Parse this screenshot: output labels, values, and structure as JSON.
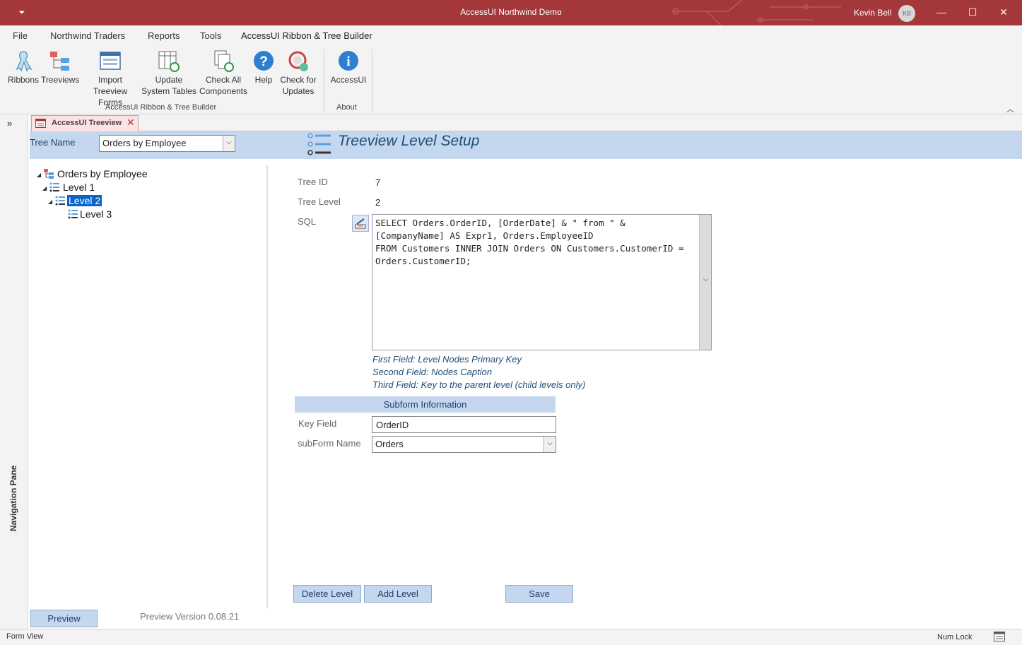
{
  "window": {
    "title": "AccessUI Northwind Demo",
    "user_name": "Kevin Bell",
    "user_initials": "KB",
    "qat_icon": "customize-quick-access-icon",
    "accent_color": "#a4373a"
  },
  "ribbon_tabs": [
    "File",
    "Northwind Traders",
    "Reports",
    "Tools",
    "AccessUI Ribbon & Tree Builder"
  ],
  "ribbon": {
    "buttons": [
      {
        "line1": "Ribbons",
        "line2": "",
        "icon": "ribbon-icon"
      },
      {
        "line1": "Treeviews",
        "line2": "",
        "icon": "treeview-icon"
      },
      {
        "line1": "Import",
        "line2": "Treeview Forms",
        "icon": "form-icon"
      },
      {
        "line1": "Update",
        "line2": "System Tables",
        "icon": "table-refresh-icon"
      },
      {
        "line1": "Check All",
        "line2": "Components",
        "icon": "check-components-icon"
      },
      {
        "line1": "Help",
        "line2": "",
        "icon": "help-icon"
      },
      {
        "line1": "Check for",
        "line2": "Updates",
        "icon": "update-icon"
      },
      {
        "line1": "AccessUI",
        "line2": "",
        "icon": "info-icon"
      }
    ],
    "group1_label": "AccessUI Ribbon & Tree Builder",
    "group2_label": "About"
  },
  "nav_pane": {
    "label": "Navigation Pane",
    "toggle": "»"
  },
  "doc_tab": {
    "label": "AccessUI Treeview",
    "close": "✕"
  },
  "form": {
    "tree_name_label": "Tree Name",
    "tree_name_value": "Orders by Employee",
    "title": "Treeview Level Setup",
    "tree": [
      {
        "label": "Orders by Employee",
        "level": 0,
        "expanded": true,
        "selected": false
      },
      {
        "label": "Level 1",
        "level": 1,
        "expanded": true,
        "selected": false
      },
      {
        "label": "Level 2",
        "level": 2,
        "expanded": true,
        "selected": true
      },
      {
        "label": "Level 3",
        "level": 3,
        "expanded": false,
        "selected": false
      }
    ],
    "tree_id_label": "Tree ID",
    "tree_id_value": "7",
    "tree_level_label": "Tree Level",
    "tree_level_value": "2",
    "sql_label": "SQL",
    "sql_value": "SELECT Orders.OrderID, [OrderDate] & \" from \" & [CompanyName] AS Expr1, Orders.EmployeeID\nFROM Customers INNER JOIN Orders ON Customers.CustomerID = Orders.CustomerID;",
    "notes": [
      "First Field: Level Nodes Primary Key",
      "Second Field: Nodes Caption",
      "Third Field:  Key to the parent level (child levels only)"
    ],
    "subform_header": "Subform Information",
    "key_field_label": "Key Field",
    "key_field_value": "OrderID",
    "subform_name_label": "subForm Name",
    "subform_name_value": "Orders",
    "buttons": {
      "delete": "Delete Level",
      "add": "Add Level",
      "save": "Save",
      "preview": "Preview"
    },
    "version": "Preview Version 0.08.21"
  },
  "status": {
    "left": "Form View",
    "num_lock": "Num Lock"
  }
}
